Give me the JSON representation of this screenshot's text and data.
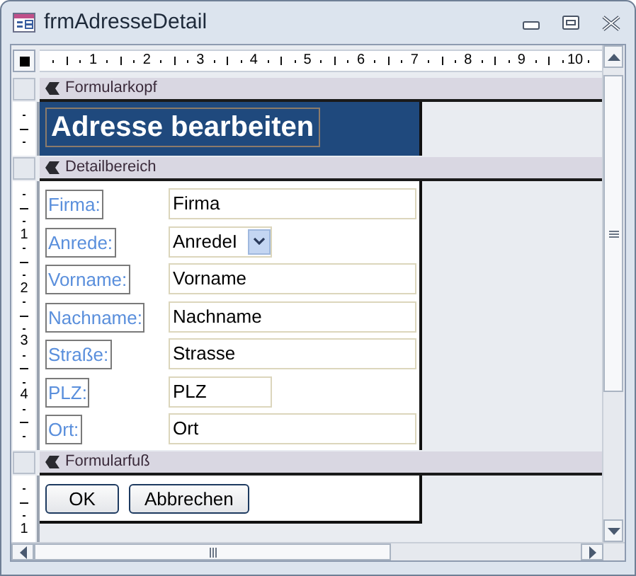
{
  "window": {
    "title": "frmAdresseDetail"
  },
  "ruler": {
    "marks": [
      "1",
      "2",
      "3",
      "4",
      "5",
      "6",
      "7",
      "8",
      "9",
      "10"
    ]
  },
  "header_section": {
    "title": "Formularkopf",
    "heading": "Adresse bearbeiten"
  },
  "detail_section": {
    "title": "Detailbereich",
    "ruler_marks": [
      "1",
      "2",
      "3",
      "4"
    ],
    "rows": [
      {
        "label": "Firma:",
        "kind": "text",
        "value": "Firma"
      },
      {
        "label": "Anrede:",
        "kind": "combo",
        "value": "AnredeI"
      },
      {
        "label": "Vorname:",
        "kind": "text",
        "value": "Vorname"
      },
      {
        "label": "Nachname:",
        "kind": "text",
        "value": "Nachname"
      },
      {
        "label": "Straße:",
        "kind": "text",
        "value": "Strasse"
      },
      {
        "label": "PLZ:",
        "kind": "short",
        "value": "PLZ"
      },
      {
        "label": "Ort:",
        "kind": "text",
        "value": "Ort"
      }
    ]
  },
  "footer_section": {
    "title": "Formularfuß",
    "ruler_marks": [
      "1"
    ],
    "buttons": [
      "OK",
      "Abbrechen"
    ]
  }
}
